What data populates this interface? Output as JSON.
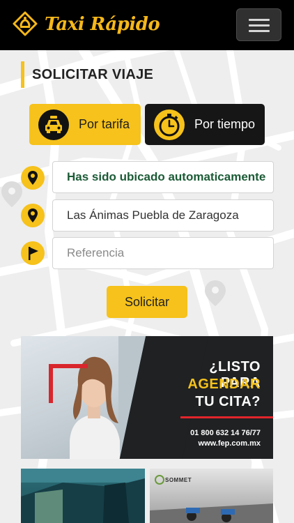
{
  "app": {
    "brand_name": "Taxi Rápido",
    "accent_color": "#f6c21b",
    "menu_icon": "hamburger-menu-icon"
  },
  "request": {
    "section_title": "SOLICITAR VIAJE",
    "modes": [
      {
        "label": "Por tarifa",
        "icon": "taxi-icon",
        "selected": true
      },
      {
        "label": "Por tiempo",
        "icon": "stopwatch-icon",
        "selected": false
      }
    ],
    "location_status": "Has sido ubicado automaticamente",
    "origin_value": "Las Ánimas Puebla de Zaragoza",
    "reference_placeholder": "Referencia",
    "submit_label": "Solicitar"
  },
  "ads": {
    "banner": {
      "line1": "¿LISTO PARA",
      "line2": "AGENDAR",
      "line3": "TU CITA?",
      "phone": "01 800 632 14 76/77",
      "website": "www.fep.com.mx"
    },
    "tile_right_caption": "SOMMET"
  }
}
